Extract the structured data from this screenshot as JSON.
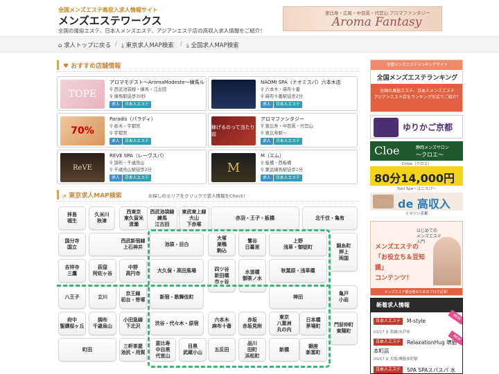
{
  "header": {
    "tagline": "全国メンズエステ高収入求人情報サイト",
    "title": "メンズエステワークス",
    "description": "全国の風俗エステ、日本人メンズエステ、アジアンエステ店の高収入求人情報をご紹介！",
    "banner": {
      "sub": "恵比寿・広尾・中目黒・代官山 アロマファンタジー",
      "main": "Aroma Fantasy"
    }
  },
  "breadcrumbs": [
    {
      "icon": "home-icon",
      "label": "求人トップに戻る"
    },
    {
      "icon": "download-arrow-icon",
      "label": "東京求人MAP検索"
    },
    {
      "icon": "download-arrow-icon",
      "label": "全国求人MAP検索"
    }
  ],
  "recommended": {
    "title": "おすすめ店舗情報",
    "cards": [
      {
        "name": "アロマモデスト～AromaModeste～練馬ルーム",
        "area": "西武池袋線・練馬・江古田",
        "access": "練馬駅徒歩30秒",
        "tags": [
          "求人",
          "日本人エステ"
        ],
        "thumb": "TOPE"
      },
      {
        "name": "NAOMI SPA（ナオミスパ）六本木店",
        "area": "六本木・麻布十番",
        "access": "麻布十番駅徒歩2分",
        "tags": [
          "求人",
          "日本人エステ"
        ],
        "thumb": ""
      },
      {
        "name": "Paradis（パラディ）",
        "area": "栃木・宇都宮",
        "access": "宇都宮",
        "tags": [
          "求人",
          "日本人エステ"
        ],
        "thumb": "70%"
      },
      {
        "name": "アロマファンタジー",
        "area": "恵比寿・中目黒・代官山",
        "access": "恵比寿駅～",
        "tags": [
          "求人",
          "日本人エステ"
        ],
        "thumb": "稼げるのって当たり前"
      },
      {
        "name": "REVE SPA（レーヴスパ）",
        "area": "調布・千歳烏山",
        "access": "千歳烏山駅徒歩2分",
        "tags": [
          "求人",
          "日本人エステ"
        ],
        "thumb": "ReVE"
      },
      {
        "name": "M（エム）",
        "area": "板橋・西板橋",
        "access": "東武練馬駅徒歩1分",
        "tags": [
          "求人",
          "日本人エステ"
        ],
        "thumb": "M"
      }
    ]
  },
  "map": {
    "title": "東京求人MAP検索",
    "hint": "お探しのエリアをクリックで求人情報をCheck!",
    "areas": [
      "拝島\n福生",
      "久米川\n秋津",
      "西東京\n東久留米\n清瀬",
      "西武池袋線\n練馬\n江古田",
      "東武東上線\n大山\n下赤塚",
      "赤羽・王子・板橋",
      "北千住・亀有",
      "国分寺\n国立",
      "西武新宿線\n上石神井",
      "池袋・目白",
      "大塚\n巣鴨\n駒込",
      "鶯谷\n日暮里",
      "上野\n浅草・御徒町",
      "錦糸町\n押上\n両国",
      "吉祥寺\n三鷹",
      "荻窪\n阿佐ヶ谷",
      "中野\n高円寺",
      "大久保・高田馬場",
      "四ツ谷\n新田橋\n市ヶ谷",
      "水道橋\n御茶ノ水",
      "秋葉原・浅草橋",
      "八王子",
      "立川",
      "京王線\n初台・笹塚",
      "新宿・歌舞伎町",
      "神田",
      "亀戸\n小岩",
      "府中\n聖蹟桜ヶ丘",
      "調布\n千歳烏山",
      "小田急線\n下北沢",
      "渋谷・代々木・原宿",
      "六本木\n麻布十番",
      "赤坂\n赤坂見附",
      "東京\n八重洲\n丸の内",
      "日本橋\n茅場町",
      "門前仲町\n東陽町",
      "町田",
      "三軒茶屋\n池尻・用賀",
      "恵比寿\n中目黒\n代官山",
      "目黒\n武蔵小山",
      "五反田",
      "品川\n田町\n浜松町",
      "新橋",
      "銀座\n新富町"
    ]
  },
  "sidebar": {
    "ranking": {
      "top": "全国メンズエステランキングサイト",
      "title": "全国メンズエステランキング",
      "desc": "全国の風俗エステ、日本人メンズエステ\nアジアンエステ店をランキング形式でご紹介！"
    },
    "yurikago": {
      "text": "ゆりかご京都"
    },
    "cloe": {
      "logo": "Cloe",
      "sub": "静岡メンズサロン",
      "name": "～クロエ～",
      "caption": "Chloe（クロエ）"
    },
    "yuni": {
      "text": "80分14,000円",
      "caption": "Yuni Spa～ユニスパ～"
    },
    "dekou": {
      "text": "de 高収入",
      "caption": "イマジン京都"
    },
    "howto": {
      "small": "はじめての\nメンズエステ入門",
      "main": "メンズエステの\n「お役立ち＆豆知識」\nコンテンツ！",
      "footer": "メンズエステ都合者のためのブログ記事！"
    },
    "new_jobs": {
      "title": "新着求人情報",
      "items": [
        {
          "badge": "日本人エステ",
          "name": "M-style",
          "date": "09/17 ♀ 茨城/水戸市"
        },
        {
          "badge": "日本人エステ",
          "name": "RelaxationHug 堺筋",
          "name2": "本町店",
          "date": "09/17 ♀ 大阪/堺筋本町駅"
        },
        {
          "badge": "日本人エステ",
          "name": "SPA SPAスパスパ 水",
          "date": ""
        }
      ],
      "new_label": "NEW"
    }
  },
  "colors": {
    "accent": "#c9883b",
    "tag_blue": "#3d8fc6",
    "tag_teal": "#2e9fb4",
    "map_dash": "#3db37a",
    "badge_red": "#c0392b"
  }
}
